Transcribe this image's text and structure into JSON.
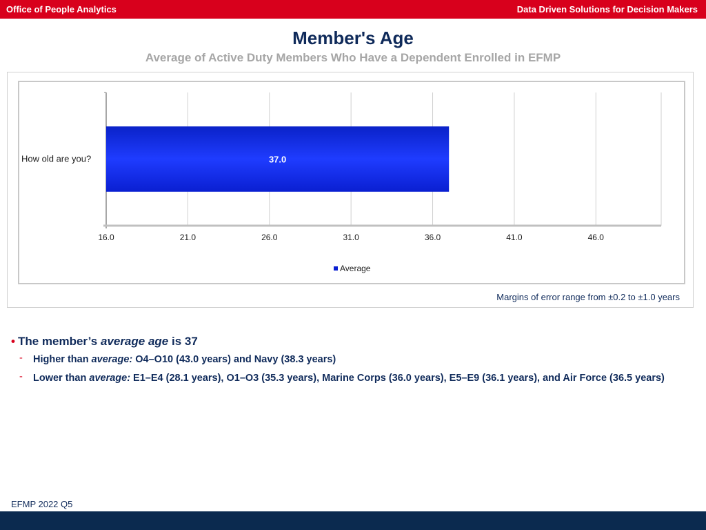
{
  "header": {
    "left": "Office of People Analytics",
    "right": "Data Driven Solutions for Decision Makers"
  },
  "title": "Member's Age",
  "subtitle": "Average of Active Duty Members Who Have a Dependent Enrolled in EFMP",
  "chart_data": {
    "type": "bar",
    "orientation": "horizontal",
    "categories": [
      "How old are you?"
    ],
    "series": [
      {
        "name": "Average",
        "values": [
          37.0
        ],
        "value_labels": [
          "37.0"
        ]
      }
    ],
    "xlim": [
      16.0,
      50.0
    ],
    "x_ticks": [
      16.0,
      21.0,
      26.0,
      31.0,
      36.0,
      41.0,
      46.0
    ],
    "x_tick_labels": [
      "16.0",
      "21.0",
      "26.0",
      "31.0",
      "36.0",
      "41.0",
      "46.0"
    ],
    "grid": true,
    "legend_position": "bottom",
    "bar_color": "#0a1fd1"
  },
  "margin_note": "Margins of error range from ±0.2 to ±1.0 years",
  "bullets": {
    "main_prefix": "The member’s ",
    "main_emph": "average age",
    "main_suffix": " is 37",
    "items": [
      {
        "prefix": "Higher than ",
        "emph": "average:",
        "text": " O4–O10 (43.0 years) and Navy (38.3 years)"
      },
      {
        "prefix": "Lower than ",
        "emph": "average:",
        "text": " E1–E4 (28.1 years), O1–O3 (35.3 years), Marine Corps (36.0 years), E5–E9 (36.1 years), and Air Force (36.5 years)"
      }
    ]
  },
  "footer": {
    "label": "EFMP 2022 Q5"
  },
  "colors": {
    "header_red": "#d8001c",
    "navy": "#0f2a5a",
    "footer_navy": "#0b2a4f"
  }
}
